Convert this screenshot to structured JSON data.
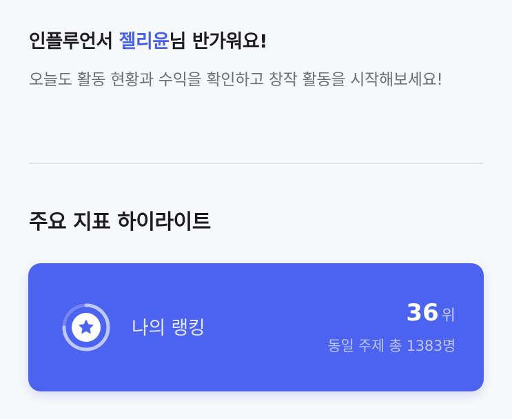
{
  "greeting": {
    "prefix": "인플루언서 ",
    "name": "젤리윤",
    "suffix": "님 반가워요!"
  },
  "subtitle": "오늘도 활동 현황과 수익을 확인하고 창작 활동을 시작해보세요!",
  "section": {
    "title": "주요 지표 하이라이트"
  },
  "rank_card": {
    "label": "나의 랭킹",
    "rank": "36",
    "unit": "위",
    "subtext": "동일 주제 총 1383명",
    "icon": "star-icon",
    "background_color": "#4b63ee",
    "progress_fraction": 0.75
  },
  "colors": {
    "accent": "#4a60e6",
    "card": "#4b63ee",
    "background": "#f7f8fa"
  }
}
